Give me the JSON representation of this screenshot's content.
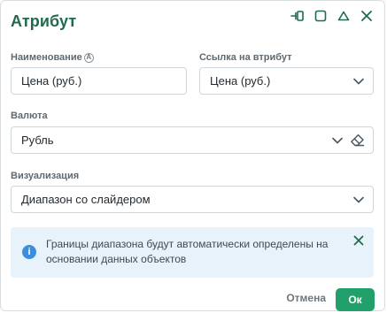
{
  "dialog": {
    "title": "Атрибут",
    "controls": [
      "pin-icon",
      "maximize-icon",
      "collapse-icon",
      "close-icon"
    ]
  },
  "fields": {
    "name": {
      "label": "Наименование",
      "badge": "A",
      "value": "Цена (руб.)"
    },
    "attribute_ref": {
      "label": "Ссылка на втрибут",
      "value": "Цена (руб.)"
    },
    "currency": {
      "label": "Валюта",
      "value": "Рубль"
    },
    "visualization": {
      "label": "Визуализация",
      "value": "Диапазон со слайдером"
    }
  },
  "info": {
    "icon": "info-icon",
    "text": "Границы диапазона будут автоматически определены на основании данных объектов"
  },
  "footer": {
    "cancel_label": "Отмена",
    "ok_label": "Ок"
  },
  "colors": {
    "title": "#1f6b4d",
    "ok_button": "#22a06b",
    "info_bg": "#e8f2fb",
    "info_icon": "#3a8edb"
  }
}
